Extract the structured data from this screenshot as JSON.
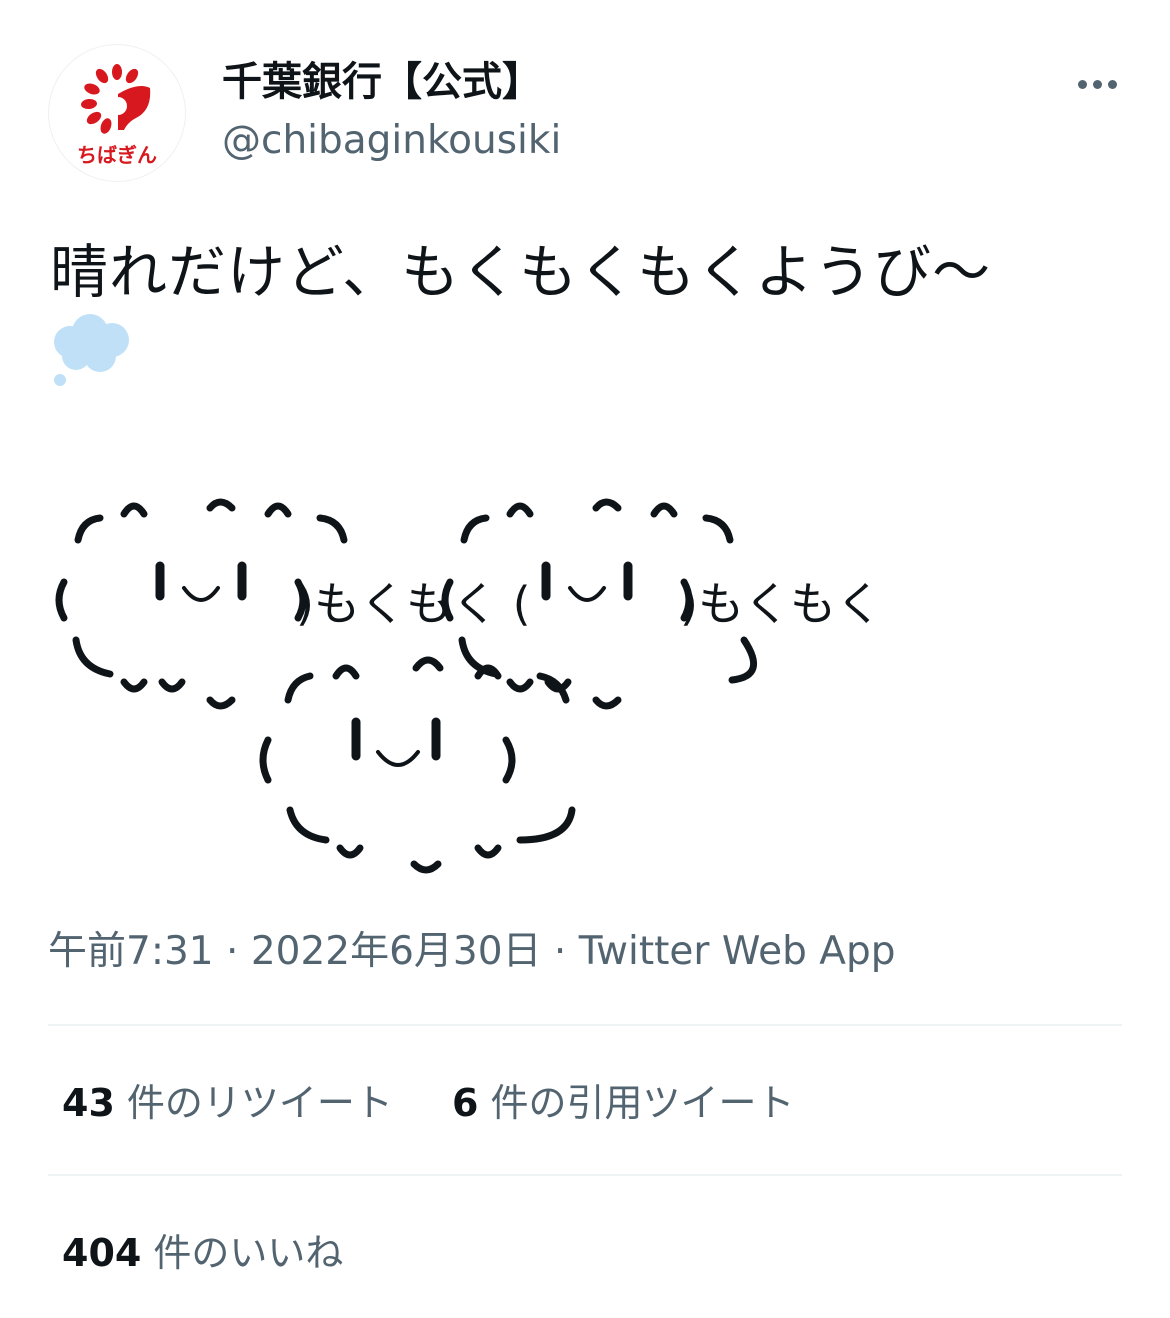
{
  "author": {
    "name": "千葉銀行【公式】",
    "handle": "@chibaginkousiki",
    "avatar_logo_text": "ちばぎん",
    "avatar_icon": "chibagin-logo"
  },
  "more_icon": "more-dots-icon",
  "tweet": {
    "text": "晴れだけど、もくもくもくようび〜",
    "emoji": "thought-balloon-emoji",
    "art_label_1": ")もくもく (",
    "art_label_2": ")もくもく"
  },
  "meta": {
    "time": "午前7:31",
    "sep1": "·",
    "date": "2022年6月30日",
    "sep2": "·",
    "source": "Twitter Web App"
  },
  "stats": {
    "retweets_count": "43",
    "retweets_label": "件のリツイート",
    "quotes_count": "6",
    "quotes_label": "件の引用ツイート",
    "likes_count": "404",
    "likes_label": "件のいいね"
  },
  "colors": {
    "text": "#0f1419",
    "secondary": "#536471",
    "divider": "#eff3f4",
    "brand_red": "#d7191f",
    "cloud_blue": "#bfe0f7"
  }
}
